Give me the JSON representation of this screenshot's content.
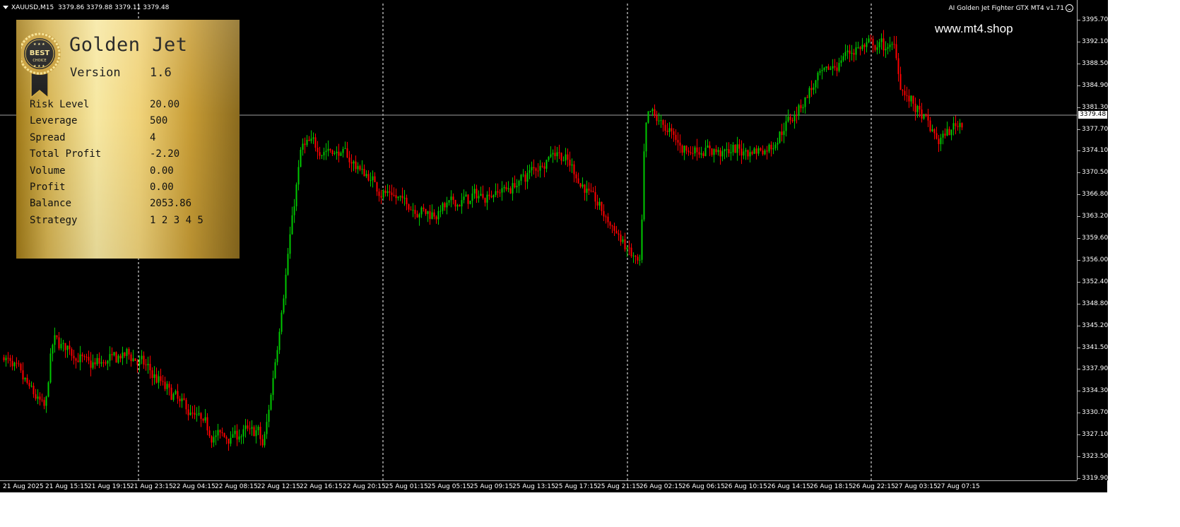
{
  "header": {
    "symbol": "XAUUSD,M15",
    "ohlc": "3379.86 3379.88 3379.11 3379.48",
    "ea_name": "AI Golden Jet Fighter GTX MT4 v1.71"
  },
  "watermark": "www.mt4.shop",
  "panel": {
    "badge_line1": "BEST",
    "badge_line2": "CHOICE",
    "title": "Golden Jet",
    "version_label": "Version",
    "version_value": "1.6",
    "rows": [
      {
        "label": "Risk Level",
        "value": "20.00"
      },
      {
        "label": "Leverage",
        "value": "500"
      },
      {
        "label": "Spread",
        "value": "4"
      },
      {
        "label": "Total Profit",
        "value": "-2.20"
      },
      {
        "label": "Volume",
        "value": "0.00"
      },
      {
        "label": "Profit",
        "value": "0.00"
      },
      {
        "label": "Balance",
        "value": "2053.86"
      },
      {
        "label": "Strategy",
        "value": "1 2 3 4 5"
      }
    ]
  },
  "price_axis": {
    "ticks": [
      "3395.70",
      "3392.10",
      "3388.50",
      "3384.90",
      "3381.30",
      "3377.70",
      "3374.10",
      "3370.50",
      "3366.80",
      "3363.20",
      "3359.60",
      "3356.00",
      "3352.40",
      "3348.80",
      "3345.20",
      "3341.50",
      "3337.90",
      "3334.30",
      "3330.70",
      "3327.10",
      "3323.50",
      "3319.90"
    ],
    "current_price": "3379.48"
  },
  "time_axis": {
    "labels": [
      "21 Aug 2025",
      "21 Aug 15:15",
      "21 Aug 19:15",
      "21 Aug 23:15",
      "22 Aug 04:15",
      "22 Aug 08:15",
      "22 Aug 12:15",
      "22 Aug 16:15",
      "22 Aug 20:15",
      "25 Aug 01:15",
      "25 Aug 05:15",
      "25 Aug 09:15",
      "25 Aug 13:15",
      "25 Aug 17:15",
      "25 Aug 21:15",
      "26 Aug 02:15",
      "26 Aug 06:15",
      "26 Aug 10:15",
      "26 Aug 14:15",
      "26 Aug 18:15",
      "26 Aug 22:15",
      "27 Aug 03:15",
      "27 Aug 07:15"
    ]
  },
  "colors": {
    "background": "#000000",
    "bull": "#00c800",
    "bear": "#ff0000",
    "grid": "#ffffff",
    "bid_line": "#a0a0a0"
  },
  "chart_data": {
    "type": "candlestick",
    "symbol": "XAUUSD",
    "timeframe": "M15",
    "ylim": [
      3319.9,
      3397.0
    ],
    "current_price": 3379.48,
    "period_separators": [
      "21 Aug 23:15",
      "22 Aug 20:15",
      "25 Aug 21:15",
      "26 Aug 22:15"
    ],
    "anchors": [
      {
        "t": "21 Aug 2025",
        "price": 3340.0
      },
      {
        "t": "21 Aug 15:15",
        "price": 3331.0
      },
      {
        "t": "21 Aug 15:15",
        "price": 3343.5
      },
      {
        "t": "21 Aug 19:15",
        "price": 3338.5
      },
      {
        "t": "21 Aug 23:15",
        "price": 3340.5
      },
      {
        "t": "22 Aug 04:15",
        "price": 3333.5
      },
      {
        "t": "22 Aug 08:15",
        "price": 3327.0
      },
      {
        "t": "22 Aug 12:15",
        "price": 3328.0
      },
      {
        "t": "22 Aug 12:15",
        "price": 3324.0
      },
      {
        "t": "22 Aug 16:15",
        "price": 3375.0
      },
      {
        "t": "22 Aug 20:15",
        "price": 3373.0
      },
      {
        "t": "25 Aug 01:15",
        "price": 3366.5
      },
      {
        "t": "25 Aug 05:15",
        "price": 3363.5
      },
      {
        "t": "25 Aug 09:15",
        "price": 3366.0
      },
      {
        "t": "25 Aug 13:15",
        "price": 3368.0
      },
      {
        "t": "25 Aug 17:15",
        "price": 3374.0
      },
      {
        "t": "25 Aug 21:15",
        "price": 3364.5
      },
      {
        "t": "26 Aug 02:15",
        "price": 3354.0
      },
      {
        "t": "26 Aug 02:15",
        "price": 3381.0
      },
      {
        "t": "26 Aug 06:15",
        "price": 3374.0
      },
      {
        "t": "26 Aug 10:15",
        "price": 3373.5
      },
      {
        "t": "26 Aug 14:15",
        "price": 3374.0
      },
      {
        "t": "26 Aug 18:15",
        "price": 3384.0
      },
      {
        "t": "26 Aug 22:15",
        "price": 3390.5
      },
      {
        "t": "27 Aug 03:15",
        "price": 3390.5
      },
      {
        "t": "27 Aug 03:15",
        "price": 3384.0
      },
      {
        "t": "27 Aug 07:15",
        "price": 3375.0
      },
      {
        "t": "27 Aug 07:15",
        "price": 3379.48
      }
    ]
  }
}
